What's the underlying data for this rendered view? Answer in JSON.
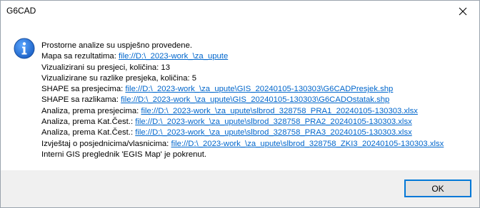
{
  "window": {
    "title": "G6CAD"
  },
  "colors": {
    "link": "#0066cc",
    "icon": "#1a6fd0",
    "footer": "#f0f0f0",
    "button_border": "#0078d7"
  },
  "icon": "info-icon",
  "message": {
    "lines": [
      {
        "label": "Prostorne analize su uspješno provedene.",
        "link": ""
      },
      {
        "label": "Mapa sa rezultatima: ",
        "link": "file://D:\\_2023-work_\\za_upute"
      },
      {
        "label": "Vizualizirani su presjeci, količina: 13",
        "link": ""
      },
      {
        "label": "Vizualizirane su razlike presjeka, količina: 5",
        "link": ""
      },
      {
        "label": "SHAPE sa presjecima: ",
        "link": "file://D:\\_2023-work_\\za_upute\\GIS_20240105-130303\\G6CADPresjek.shp"
      },
      {
        "label": "SHAPE sa razlikama: ",
        "link": "file://D:\\_2023-work_\\za_upute\\GIS_20240105-130303\\G6CADOstatak.shp"
      },
      {
        "label": "Analiza, prema presjecima: ",
        "link": "file://D:\\_2023-work_\\za_upute\\slbrod_328758_PRA1_20240105-130303.xlsx"
      },
      {
        "label": "Analiza, prema Kat.Čest.: ",
        "link": "file://D:\\_2023-work_\\za_upute\\slbrod_328758_PRA2_20240105-130303.xlsx"
      },
      {
        "label": "Analiza, prema Kat.Čest.: ",
        "link": "file://D:\\_2023-work_\\za_upute\\slbrod_328758_PRA3_20240105-130303.xlsx"
      },
      {
        "label": "Izvještaj o posjednicima/vlasnicima: ",
        "link": "file://D:\\_2023-work_\\za_upute\\slbrod_328758_ZKI3_20240105-130303.xlsx"
      },
      {
        "label": "Interni GIS preglednik 'EGIS Map' je pokrenut.",
        "link": ""
      }
    ]
  },
  "buttons": {
    "ok_label": "OK"
  }
}
